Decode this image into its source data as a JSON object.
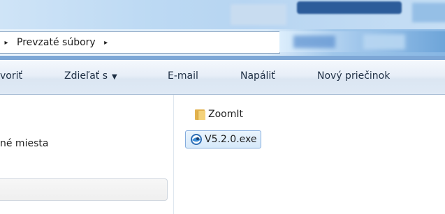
{
  "address_bar": {
    "leading_arrow": "▸",
    "crumb": "Prevzaté súbory",
    "trailing_arrow": "▸"
  },
  "command_bar": {
    "open_label": "voriť",
    "share_label": "Zdieľať s",
    "share_caret": "▼",
    "email_label": "E-mail",
    "burn_label": "Napáliť",
    "new_folder_label": "Nový priečinok"
  },
  "nav_pane": {
    "item_label": "né miesta"
  },
  "files": [
    {
      "name": "ZoomIt",
      "icon": "folder-icon",
      "selected": false
    },
    {
      "name": "V5.2.0.exe",
      "icon": "exe-app-icon",
      "selected": true
    }
  ],
  "colors": {
    "selection_border": "#84acdd",
    "selection_fill": "#d6e9fa",
    "folder": "#e2b24e",
    "command_text": "#1e2f44"
  }
}
